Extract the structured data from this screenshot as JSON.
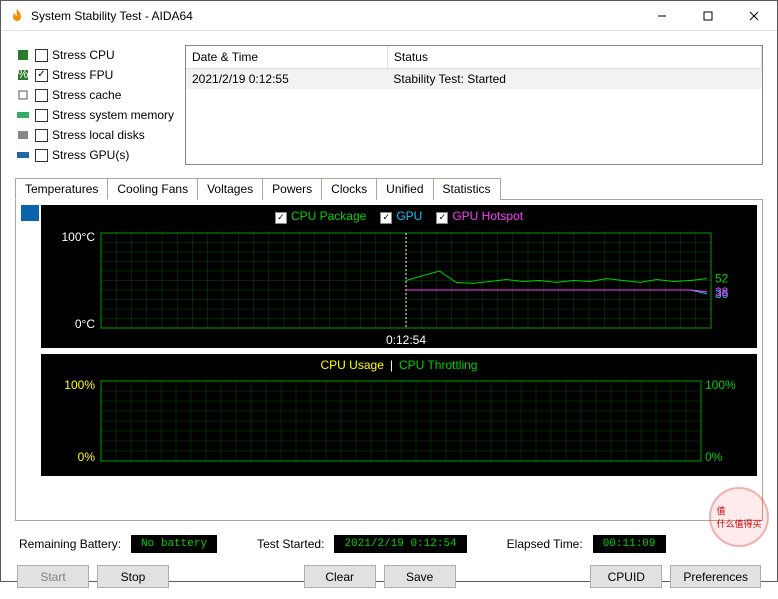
{
  "window": {
    "title": "System Stability Test - AIDA64"
  },
  "stress": {
    "items": [
      {
        "label": "Stress CPU",
        "checked": false
      },
      {
        "label": "Stress FPU",
        "checked": true
      },
      {
        "label": "Stress cache",
        "checked": false
      },
      {
        "label": "Stress system memory",
        "checked": false
      },
      {
        "label": "Stress local disks",
        "checked": false
      },
      {
        "label": "Stress GPU(s)",
        "checked": false
      }
    ]
  },
  "log": {
    "headers": [
      "Date & Time",
      "Status"
    ],
    "rows": [
      [
        "2021/2/19 0:12:55",
        "Stability Test: Started"
      ]
    ]
  },
  "tabs": [
    "Temperatures",
    "Cooling Fans",
    "Voltages",
    "Powers",
    "Clocks",
    "Unified",
    "Statistics"
  ],
  "chart_data": [
    {
      "type": "line",
      "title": "Temperatures",
      "ylabel": "°C",
      "ylim": [
        0,
        100
      ],
      "x_time_label": "0:12:54",
      "series": [
        {
          "name": "CPU Package",
          "color": "#00d000",
          "end_value": 52,
          "values": [
            50,
            55,
            60,
            48,
            47,
            49,
            51,
            49,
            50,
            48,
            50,
            49,
            52,
            50,
            48,
            51,
            49,
            50,
            52
          ]
        },
        {
          "name": "GPU",
          "color": "#00c8ff",
          "end_value": 36,
          "values": [
            40,
            40,
            40,
            40,
            40,
            40,
            40,
            40,
            40,
            40,
            40,
            40,
            40,
            40,
            40,
            40,
            40,
            40,
            36
          ]
        },
        {
          "name": "GPU Hotspot",
          "color": "#ff3cff",
          "end_value": 38,
          "values": [
            40,
            40,
            40,
            40,
            40,
            40,
            40,
            40,
            40,
            40,
            40,
            40,
            40,
            40,
            40,
            40,
            40,
            40,
            38
          ]
        }
      ]
    },
    {
      "type": "line",
      "title": "CPU Usage / Throttling",
      "ylabel": "%",
      "ylim": [
        0,
        100
      ],
      "series": [
        {
          "name": "CPU Usage",
          "color": "#ffff00",
          "values": []
        },
        {
          "name": "CPU Throttling",
          "color": "#00d000",
          "values": []
        }
      ],
      "left_labels": {
        "top": "100%",
        "bottom": "0%"
      },
      "right_labels": {
        "top": "100%",
        "bottom": "0%"
      }
    }
  ],
  "status": {
    "battery_label": "Remaining Battery:",
    "battery_value": "No battery",
    "started_label": "Test Started:",
    "started_value": "2021/2/19 0:12:54",
    "elapsed_label": "Elapsed Time:",
    "elapsed_value": "00:11:09"
  },
  "buttons": {
    "start": "Start",
    "stop": "Stop",
    "clear": "Clear",
    "save": "Save",
    "cpuid": "CPUID",
    "prefs": "Preferences"
  },
  "axis": {
    "t100": "100°C",
    "t0": "0°C"
  }
}
